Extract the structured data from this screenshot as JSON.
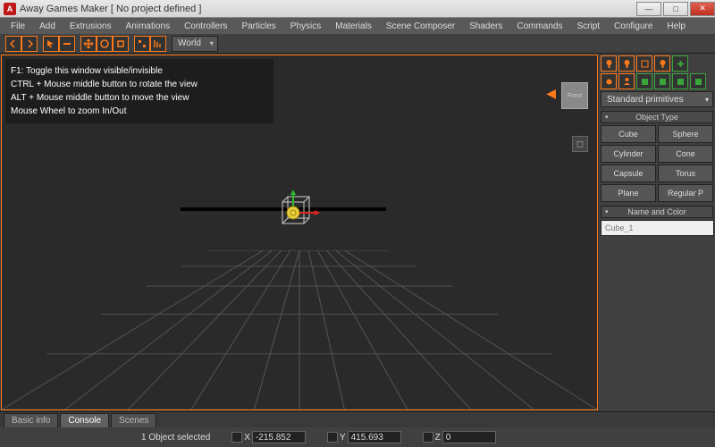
{
  "window": {
    "title": "Away Games Maker [ No project defined ]"
  },
  "menu": [
    "File",
    "Add",
    "Extrusions",
    "Animations",
    "Controllers",
    "Particles",
    "Physics",
    "Materials",
    "Scene Composer",
    "Shaders",
    "Commands",
    "Script",
    "Configure",
    "Help"
  ],
  "toolbar": {
    "coord_space": "World"
  },
  "help": {
    "l1": "F1: Toggle this window visible/invisible",
    "l2": "CTRL + Mouse middle button to rotate the view",
    "l3": "ALT + Mouse middle button to move the view",
    "l4": "Mouse Wheel to zoom In/Out"
  },
  "orient": {
    "face": "Front"
  },
  "right": {
    "dropdown": "Standard primitives",
    "section_type": "Object Type",
    "types": [
      "Cube",
      "Sphere",
      "Cylinder",
      "Cone",
      "Capsule",
      "Torus",
      "Plane",
      "Regular P"
    ],
    "section_name": "Name and Color",
    "name_placeholder": "Cube_1",
    "swatch": "#3090b0"
  },
  "tabs": {
    "t1": "Basic info",
    "t2": "Console",
    "t3": "Scenes"
  },
  "status": {
    "selection": "1 Object selected",
    "x_label": "X",
    "x": "-215.852",
    "y_label": "Y",
    "y": "415.693",
    "z_label": "Z",
    "z": "0"
  }
}
